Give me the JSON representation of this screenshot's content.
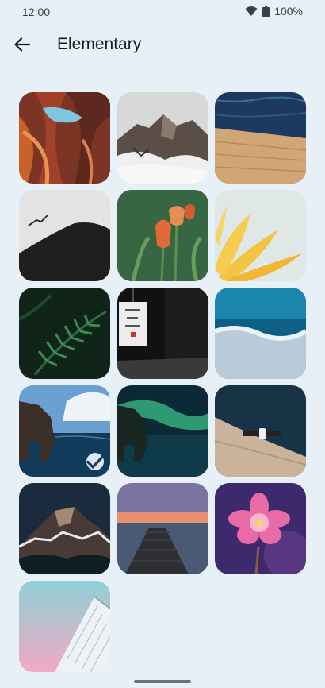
{
  "status_bar": {
    "time": "12:00",
    "battery": "100%"
  },
  "app_bar": {
    "title": "Elementary"
  },
  "wallpapers": [
    {
      "id": "canyon",
      "selected": false
    },
    {
      "id": "snowy-mountain",
      "selected": false
    },
    {
      "id": "dock-water",
      "selected": false
    },
    {
      "id": "bird-hill",
      "selected": false
    },
    {
      "id": "tulips",
      "selected": false
    },
    {
      "id": "yellow-leaves",
      "selected": false
    },
    {
      "id": "fern",
      "selected": false
    },
    {
      "id": "lantern",
      "selected": false
    },
    {
      "id": "ocean-aerial",
      "selected": false
    },
    {
      "id": "sea-arch",
      "selected": true
    },
    {
      "id": "aurora-arch",
      "selected": false
    },
    {
      "id": "satellite",
      "selected": false
    },
    {
      "id": "half-dome",
      "selected": false
    },
    {
      "id": "pier-sunset",
      "selected": false
    },
    {
      "id": "pink-dahlia",
      "selected": false
    },
    {
      "id": "building-sky",
      "selected": false
    }
  ]
}
